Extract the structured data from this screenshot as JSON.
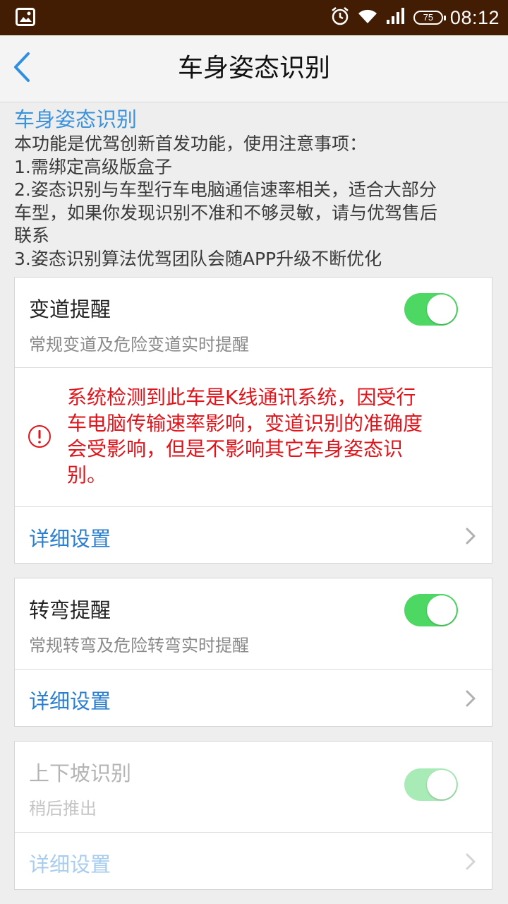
{
  "status_bar": {
    "time": "08:12",
    "battery": "75",
    "icons": [
      "image-icon",
      "alarm-icon",
      "wifi-icon",
      "signal-icon",
      "battery-icon"
    ]
  },
  "nav": {
    "title": "车身姿态识别",
    "back_icon": "chevron-left-icon"
  },
  "intro": {
    "title": "车身姿态识别",
    "lines": [
      "本功能是优驾创新首发功能，使用注意事项：",
      "1.需绑定高级版盒子",
      "2.姿态识别与车型行车电脑通信速率相关，适合大部分",
      "车型，如果你发现识别不准和不够灵敏，请与优驾售后",
      "联系",
      "3.姿态识别算法优驾团队会随APP升级不断优化"
    ]
  },
  "lane_change": {
    "title": "变道提醒",
    "subtitle": "常规变道及危险变道实时提醒",
    "enabled": true,
    "warning_lines": [
      "系统检测到此车是K线通讯系统，因受行",
      "车电脑传输速率影响，变道识别的准确度",
      "会受影响，但是不影响其它车身姿态识",
      "别。"
    ],
    "detail_label": "详细设置"
  },
  "turn": {
    "title": "转弯提醒",
    "subtitle": "常规转弯及危险转弯实时提醒",
    "enabled": true,
    "detail_label": "详细设置"
  },
  "slope": {
    "title": "上下坡识别",
    "subtitle": "稍后推出",
    "enabled": true,
    "disabled": true,
    "detail_label": "详细设置"
  },
  "colors": {
    "status_bar": "#421d04",
    "accent_blue": "#3d93d9",
    "toggle_on": "#4cd863",
    "warning_red": "#e1131a"
  }
}
